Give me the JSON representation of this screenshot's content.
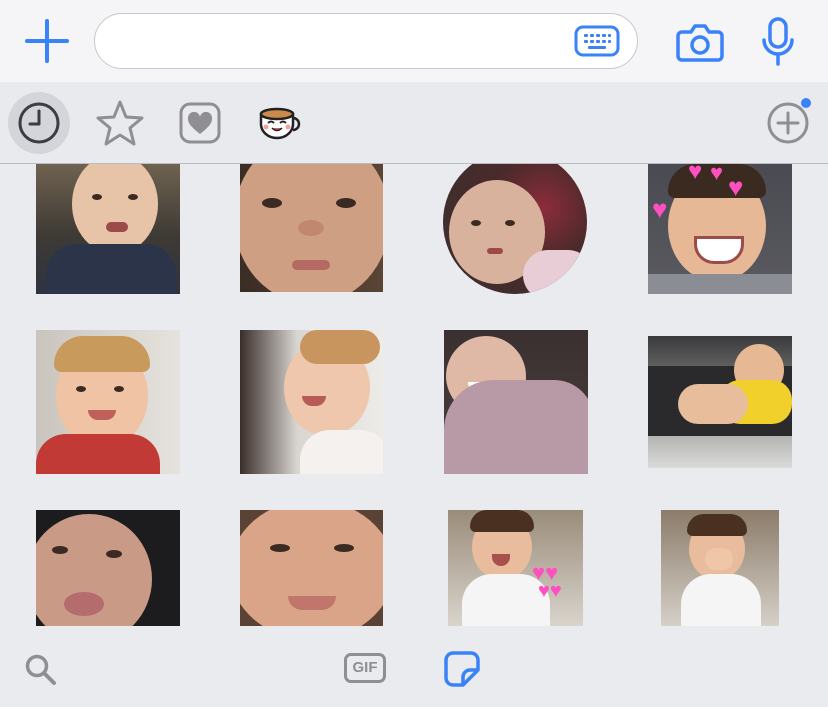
{
  "composer": {
    "message_value": "",
    "message_placeholder": "",
    "icons": [
      "plus-icon",
      "keyboard-icon",
      "camera-icon",
      "microphone-icon"
    ]
  },
  "sticker_tabs": [
    {
      "name": "recents",
      "icon": "clock-icon",
      "selected": true
    },
    {
      "name": "favorites",
      "icon": "star-icon",
      "selected": false
    },
    {
      "name": "created",
      "icon": "heart-icon",
      "selected": false
    },
    {
      "name": "pack-cup",
      "icon": "cup-sticker-icon",
      "selected": false
    },
    {
      "name": "add-pack",
      "icon": "add-circle-icon",
      "badge": "new-dot",
      "selected": false
    }
  ],
  "stickers": [
    {
      "row": 1,
      "col": 1,
      "description": "baby-pouting"
    },
    {
      "row": 1,
      "col": 2,
      "description": "baby-sad-closeup"
    },
    {
      "row": 1,
      "col": 3,
      "description": "baby-round-sticker",
      "shape": "circle"
    },
    {
      "row": 1,
      "col": 4,
      "description": "toddler-laughing-hearts"
    },
    {
      "row": 2,
      "col": 1,
      "description": "toddler-smiling-red-shirt"
    },
    {
      "row": 2,
      "col": 2,
      "description": "baby-giggling"
    },
    {
      "row": 2,
      "col": 3,
      "description": "baby-in-blanket-laughing"
    },
    {
      "row": 2,
      "col": 4,
      "description": "baby-yellow-shirt-lying"
    },
    {
      "row": 3,
      "col": 1,
      "description": "baby-kissy-face"
    },
    {
      "row": 3,
      "col": 2,
      "description": "baby-grinning-closeup"
    },
    {
      "row": 3,
      "col": 3,
      "description": "toddler-blowing-hearts"
    },
    {
      "row": 3,
      "col": 4,
      "description": "toddler-hand-over-mouth"
    }
  ],
  "bottom_bar": {
    "gif_label": "GIF",
    "icons": [
      "search-icon",
      "gif-icon",
      "sticker-icon"
    ],
    "active": "sticker-icon"
  },
  "colors": {
    "accent": "#3a82f7",
    "icon_gray": "#8e8e93",
    "background": "#eaebef",
    "badge": "#3a82f7"
  }
}
